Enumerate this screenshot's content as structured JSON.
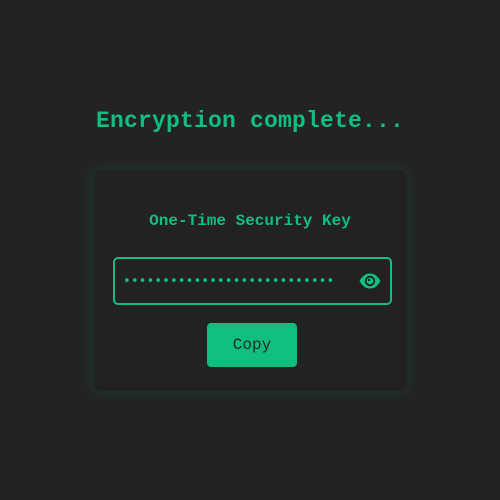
{
  "page": {
    "title": "Encryption complete..."
  },
  "card": {
    "heading": "One-Time Security Key",
    "key_field": {
      "masked_value": "•••••••••••••••••••••••••••",
      "visibility_toggle_icon": "eye-icon"
    },
    "copy_label": "Copy"
  },
  "colors": {
    "background": "#232323",
    "accent": "#10bf80",
    "card_background": "#222222",
    "button_text": "#1e2a24"
  }
}
